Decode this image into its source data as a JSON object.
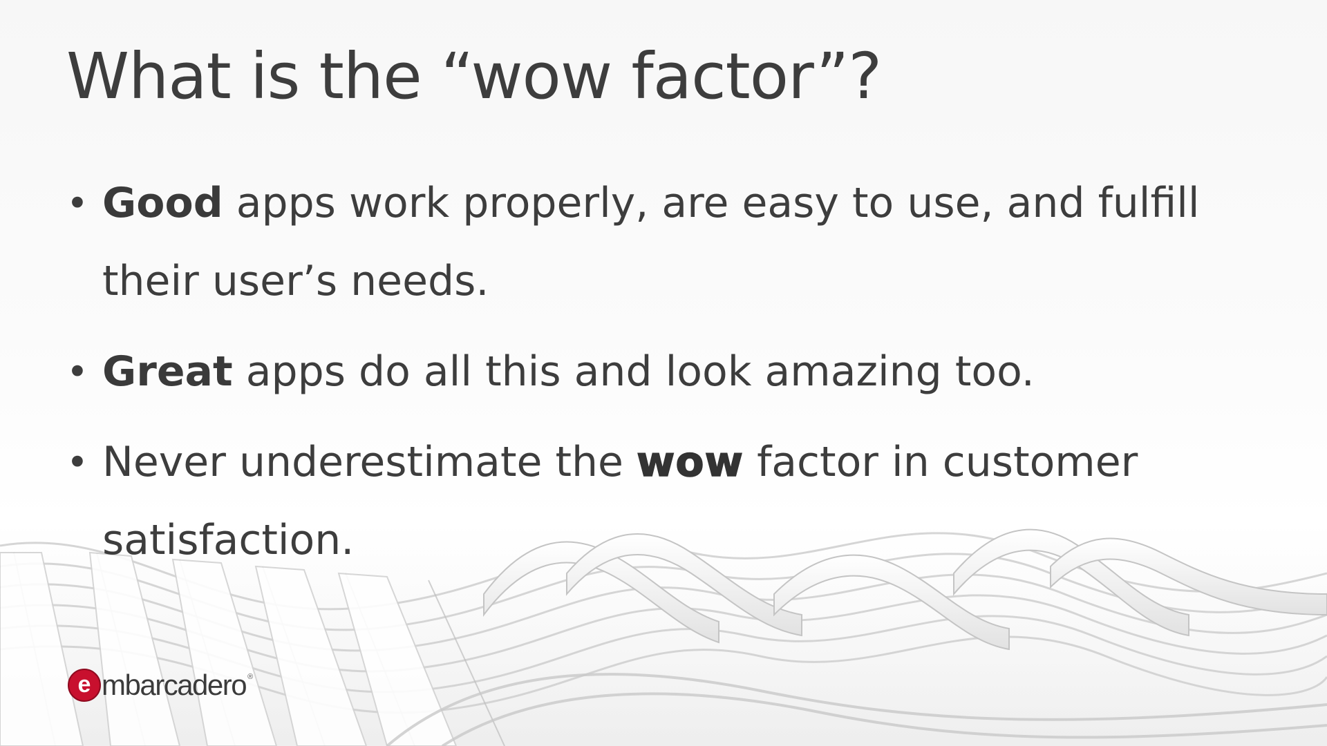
{
  "slide": {
    "title": "What is the “wow factor”?",
    "bullets": [
      {
        "bold_lead": "Good",
        "text_after": " apps work properly, are easy to use, and fulfill their user’s needs."
      },
      {
        "bold_lead": "Great",
        "text_after": " apps do all this and look amazing too."
      },
      {
        "text_before": "Never underestimate the ",
        "emphasis": "wow",
        "text_after": " factor in customer satisfaction."
      }
    ],
    "bullet_glyph": "•"
  },
  "branding": {
    "logo_text": "mbarcadero",
    "logo_mark_letter": "e",
    "registered_mark": "®",
    "logo_color": "#c8102e"
  },
  "icons": {
    "logo": "embarcadero-e-logo-icon",
    "background": "white-ribbon-waves"
  }
}
